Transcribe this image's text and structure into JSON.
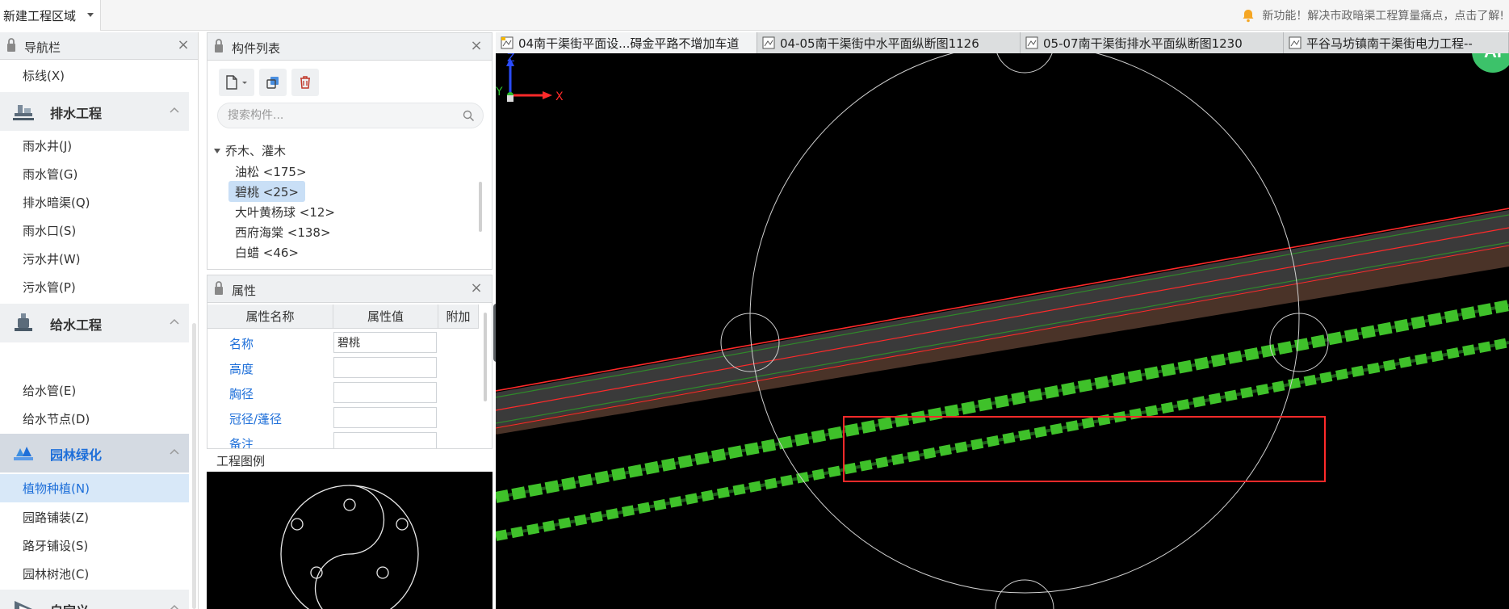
{
  "topbar": {
    "region": "新建工程区域",
    "notice": "新功能！解决市政暗渠工程算量痛点，点击了解!"
  },
  "nav": {
    "title": "导航栏",
    "items_top": [
      {
        "label": "标线(X)"
      }
    ],
    "categories": [
      {
        "label": "排水工程",
        "icon": "drain-icon",
        "items": [
          "雨水井(J)",
          "雨水管(G)",
          "排水暗渠(Q)",
          "雨水口(S)",
          "污水井(W)",
          "污水管(P)"
        ]
      },
      {
        "label": "给水工程",
        "icon": "water-supply-icon",
        "items": [
          "给水管(E)",
          "给水节点(D)"
        ]
      },
      {
        "label": "园林绿化",
        "icon": "landscape-icon",
        "items": [
          "植物种植(N)",
          "园路铺装(Z)",
          "路牙铺设(S)",
          "园林树池(C)"
        ]
      },
      {
        "label": "自定义",
        "icon": "custom-icon",
        "items": []
      }
    ],
    "active_item": "植物种植(N)"
  },
  "complist": {
    "title": "构件列表",
    "search_placeholder": "搜索构件...",
    "group": "乔木、灌木",
    "items": [
      "油松 <175>",
      "碧桃 <25>",
      "大叶黄杨球 <12>",
      "西府海棠 <138>",
      "白蜡 <46>"
    ],
    "selected": "碧桃 <25>"
  },
  "props": {
    "title": "属性",
    "headers": [
      "属性名称",
      "属性值",
      "附加"
    ],
    "rows": [
      {
        "name": "名称",
        "value": "碧桃"
      },
      {
        "name": "高度",
        "value": ""
      },
      {
        "name": "胸径",
        "value": ""
      },
      {
        "name": "冠径/蓬径",
        "value": ""
      },
      {
        "name": "备注",
        "value": ""
      }
    ]
  },
  "legend": {
    "title": "工程图例"
  },
  "tabs": [
    {
      "label": "04南干渠街平面设...碍金平路不增加车道"
    },
    {
      "label": "04-05南干渠街中水平面纵断图1126"
    },
    {
      "label": "05-07南干渠街排水平面纵断图1230"
    },
    {
      "label": "平谷马坊镇南干渠街电力工程--"
    }
  ],
  "viewport": {
    "ai_badge": "Ai",
    "axis": {
      "x": "X",
      "y": "Y",
      "z": "Z"
    }
  },
  "colors": {
    "accent": "#1e6fd9",
    "selection": "#c9dff6",
    "tree_green": "#3fc12a",
    "road_red": "#ff2a2a",
    "ai_green": "#3cc26a",
    "notice_bell": "#f5a623"
  }
}
